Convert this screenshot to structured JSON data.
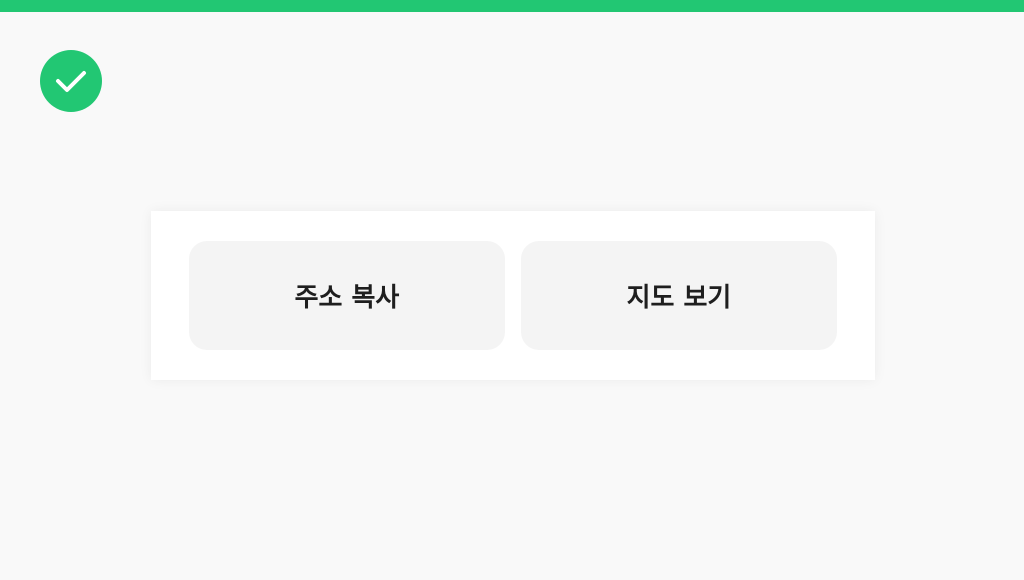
{
  "header": {
    "accent_color": "#22c773"
  },
  "status": {
    "icon": "check-circle-icon",
    "color": "#22c773"
  },
  "actions": {
    "copy_address_label": "주소 복사",
    "view_map_label": "지도 보기",
    "button_background": "#f4f4f4",
    "text_color": "#1e1e1e"
  }
}
